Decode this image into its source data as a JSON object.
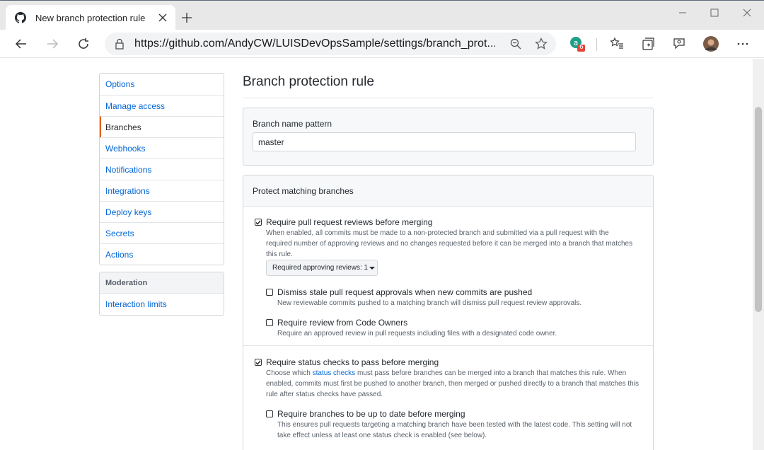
{
  "browser": {
    "tab_title": "New branch protection rule",
    "url": "https://github.com/AndyCW/LUISDevOpsSample/settings/branch_prot...",
    "extension_badge": "6"
  },
  "menu": {
    "items": [
      {
        "label": "Options"
      },
      {
        "label": "Manage access"
      },
      {
        "label": "Branches"
      },
      {
        "label": "Webhooks"
      },
      {
        "label": "Notifications"
      },
      {
        "label": "Integrations"
      },
      {
        "label": "Deploy keys"
      },
      {
        "label": "Secrets"
      },
      {
        "label": "Actions"
      }
    ],
    "selected": "Branches"
  },
  "moderation": {
    "header": "Moderation",
    "item": "Interaction limits"
  },
  "main": {
    "title": "Branch protection rule",
    "pattern_label": "Branch name pattern",
    "pattern_value": "master",
    "protect_header": "Protect matching branches",
    "options": {
      "pr_reviews": {
        "checked": true,
        "title": "Require pull request reviews before merging",
        "desc": "When enabled, all commits must be made to a non-protected branch and submitted via a pull request with the required number of approving reviews and no changes requested before it can be merged into a branch that matches this rule."
      },
      "approving_select": "Required approving reviews: 1",
      "dismiss_stale": {
        "checked": false,
        "title": "Dismiss stale pull request approvals when new commits are pushed",
        "desc": "New reviewable commits pushed to a matching branch will dismiss pull request review approvals."
      },
      "code_owners": {
        "checked": false,
        "title": "Require review from Code Owners",
        "desc": "Require an approved review in pull requests including files with a designated code owner."
      },
      "status_checks": {
        "checked": true,
        "title": "Require status checks to pass before merging",
        "desc_before": "Choose which ",
        "desc_link": "status checks",
        "desc_after": " must pass before branches can be merged into a branch that matches this rule. When enabled, commits must first be pushed to another branch, then merged or pushed directly to a branch that matches this rule after status checks have passed."
      },
      "up_to_date": {
        "checked": false,
        "title": "Require branches to be up to date before merging",
        "desc": "This ensures pull requests targeting a matching branch have been tested with the latest code. This setting will not take effect unless at least one status check is enabled (see below)."
      }
    }
  },
  "colors": {
    "link": "#0366d6",
    "selected_accent": "#e36209",
    "border": "#d1d5da"
  },
  "icons": [
    "github-icon",
    "close-icon",
    "plus-icon",
    "minimize-icon",
    "maximize-icon",
    "back-icon",
    "forward-icon",
    "refresh-icon",
    "lock-icon",
    "zoom-icon",
    "star-icon",
    "extension-icon",
    "favorites-icon",
    "collections-icon",
    "feedback-icon",
    "avatar",
    "more-icon",
    "check-icon",
    "caret-down-icon"
  ]
}
